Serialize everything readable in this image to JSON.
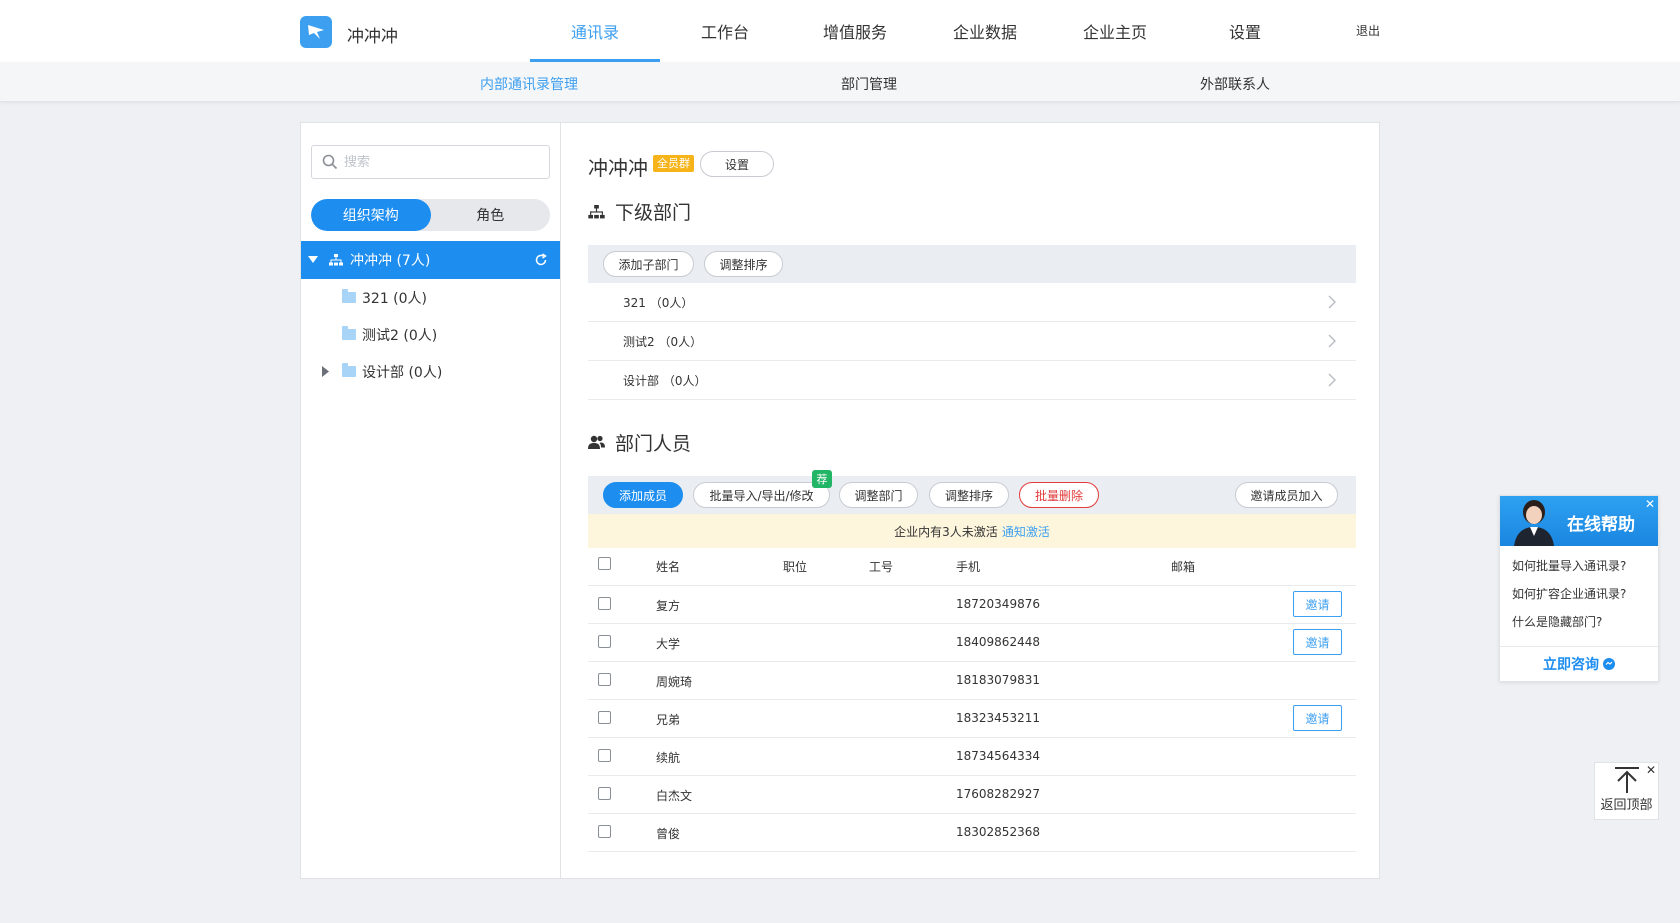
{
  "app": {
    "name": "冲冲冲"
  },
  "nav": {
    "items": [
      {
        "label": "通讯录",
        "active": true
      },
      {
        "label": "工作台"
      },
      {
        "label": "增值服务"
      },
      {
        "label": "企业数据"
      },
      {
        "label": "企业主页"
      },
      {
        "label": "设置"
      }
    ],
    "logout": "退出"
  },
  "subnav": {
    "items": [
      {
        "label": "内部通讯录管理",
        "active": true
      },
      {
        "label": "部门管理"
      },
      {
        "label": "外部联系人"
      }
    ]
  },
  "sidebar": {
    "search_placeholder": "搜索",
    "tabs": [
      {
        "label": "组织架构",
        "active": true
      },
      {
        "label": "角色"
      }
    ],
    "root": {
      "label": "冲冲冲 (7人)"
    },
    "items": [
      {
        "label": "321 (0人)"
      },
      {
        "label": "测试2 (0人)"
      },
      {
        "label": "设计部 (0人)",
        "expandable": true
      }
    ]
  },
  "dept": {
    "title": "冲冲冲",
    "badge": "全员群",
    "settings_button": "设置"
  },
  "subdepts": {
    "title": "下级部门",
    "add_button": "添加子部门",
    "sort_button": "调整排序",
    "rows": [
      "321 （0人）",
      "测试2 （0人）",
      "设计部 （0人）"
    ]
  },
  "members": {
    "title": "部门人员",
    "buttons": {
      "add": "添加成员",
      "batch": "批量导入/导出/修改",
      "batch_badge": "荐",
      "move": "调整部门",
      "sort": "调整排序",
      "delete": "批量删除",
      "invite_join": "邀请成员加入"
    },
    "notice": {
      "text": "企业内有3人未激活",
      "link": "通知激活"
    },
    "columns": {
      "name": "姓名",
      "title": "职位",
      "id": "工号",
      "phone": "手机",
      "email": "邮箱"
    },
    "invite_label": "邀请",
    "rows": [
      {
        "name": "复方",
        "phone": "18720349876",
        "invite": true
      },
      {
        "name": "大学",
        "phone": "18409862448",
        "invite": true
      },
      {
        "name": "周婉琦",
        "phone": "18183079831",
        "invite": false
      },
      {
        "name": "兄弟",
        "phone": "18323453211",
        "invite": true
      },
      {
        "name": "续航",
        "phone": "18734564334",
        "invite": false
      },
      {
        "name": "白杰文",
        "phone": "17608282927",
        "invite": false
      },
      {
        "name": "曾俊",
        "phone": "18302852368",
        "invite": false
      }
    ]
  },
  "help": {
    "title": "在线帮助",
    "close": "✕",
    "questions": [
      "如何批量导入通讯录?",
      "如何扩容企业通讯录?",
      "什么是隐藏部门?"
    ],
    "cta": "立即咨询"
  },
  "to_top": {
    "label": "返回顶部",
    "close": "✕"
  },
  "colors": {
    "accent": "#1d8ef0",
    "link": "#3d9ff0",
    "danger": "#e23b3b",
    "badge": "#f6b31a",
    "notice_bg": "#fdf6dc"
  }
}
